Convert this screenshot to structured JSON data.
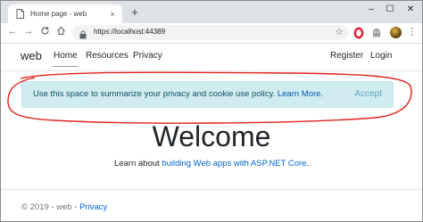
{
  "browser": {
    "tab_title": "Home page - web",
    "tab_close": "×",
    "new_tab": "+",
    "window_controls": {
      "minimize": "–",
      "maximize": "☐",
      "close": "✕"
    },
    "nav": {
      "back": "←",
      "forward": "→",
      "reload": "C",
      "home": "⌂"
    },
    "url": "https://localhost:44389",
    "bookmark_star": "☆",
    "menu": "⋮",
    "icons": [
      "page-icon",
      "lock-icon",
      "star-icon",
      "opera-icon",
      "ghost-icon",
      "avatar",
      "kebab-menu-icon"
    ]
  },
  "site": {
    "brand": "web",
    "nav_left": [
      "Home",
      "Resources",
      "Privacy"
    ],
    "nav_right": [
      "Register",
      "Login"
    ]
  },
  "cookie_banner": {
    "message": "Use this space to summarize your privacy and cookie use policy.",
    "link": "Learn More.",
    "accept": "Accept",
    "background": "#d1ecf1",
    "highlight_color": "#e0221b"
  },
  "main": {
    "heading": "Welcome",
    "lead_prefix": "Learn about ",
    "lead_link": "building Web apps with ASP.NET Core",
    "lead_suffix": "."
  },
  "footer": {
    "copyright": "© 2019 - web - ",
    "privacy_link": "Privacy"
  }
}
